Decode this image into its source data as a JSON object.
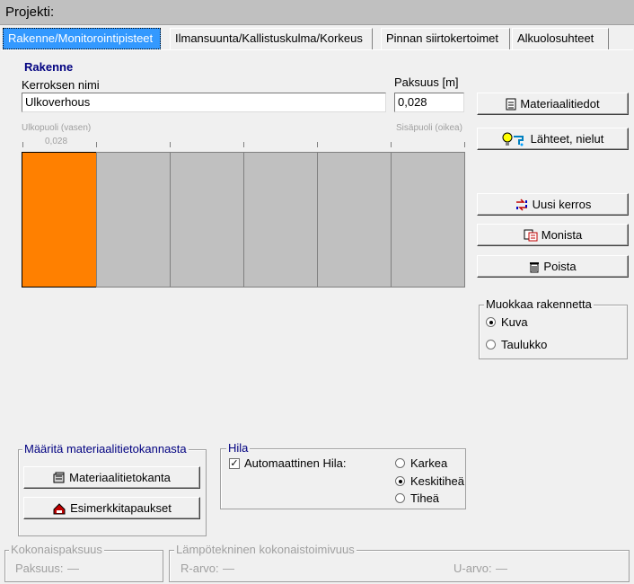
{
  "title": "Projekti:",
  "tabs": [
    {
      "label": "Rakenne/Monitorointipisteet",
      "active": true
    },
    {
      "label": "Ilmansuunta/Kallistuskulma/Korkeus"
    },
    {
      "label": "Pinnan siirtokertoimet"
    },
    {
      "label": "Alkuolosuhteet"
    }
  ],
  "structure": {
    "heading": "Rakenne",
    "layer_name_label": "Kerroksen nimi",
    "layer_name_value": "Ulkoverhous",
    "thickness_label": "Paksuus [m]",
    "thickness_value": "0,028",
    "outside_label": "Ulkopuoli (vasen)",
    "inside_label": "Sisäpuoli (oikea)",
    "selected_layer_thickness": "0,028",
    "layer_colors": [
      "#ff8000",
      "#c0c0c0",
      "#c0c0c0",
      "#c0c0c0",
      "#c0c0c0",
      "#c0c0c0"
    ]
  },
  "buttons": {
    "material_data": "Materiaalitiedot",
    "sources_sinks": "Lähteet, nielut",
    "new_layer": "Uusi kerros",
    "duplicate": "Monista",
    "delete": "Poista"
  },
  "edit_structure": {
    "title": "Muokkaa rakennetta",
    "options": [
      {
        "label": "Kuva",
        "selected": true
      },
      {
        "label": "Taulukko",
        "selected": false
      }
    ]
  },
  "material_db": {
    "title": "Määritä materiaalitietokannasta",
    "db_button": "Materiaalitietokanta",
    "examples_button": "Esimerkkitapaukset"
  },
  "grid": {
    "title": "Hila",
    "auto_label": "Automaattinen Hila:",
    "auto_checked": true,
    "options": [
      {
        "label": "Karkea",
        "selected": false
      },
      {
        "label": "Keskitiheä",
        "selected": true
      },
      {
        "label": "Tiheä",
        "selected": false
      }
    ]
  },
  "total_thickness": {
    "title": "Kokonaispaksuus",
    "label": "Paksuus:",
    "value": "—"
  },
  "thermal": {
    "title": "Lämpötekninen kokonaistoimivuus",
    "r_label": "R-arvo:",
    "r_value": "—",
    "u_label": "U-arvo:",
    "u_value": "—"
  }
}
